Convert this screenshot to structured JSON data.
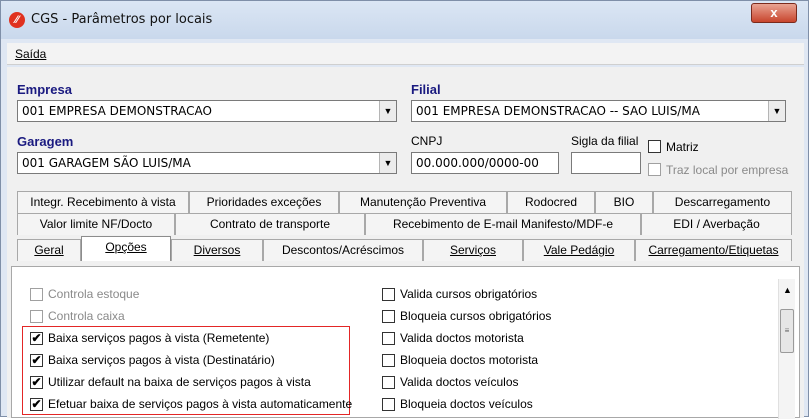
{
  "window": {
    "title": "CGS - Parâmetros por locais",
    "close_glyph": "x"
  },
  "menu": {
    "saida": "Saída"
  },
  "form": {
    "empresa_label": "Empresa",
    "empresa_value": "001 EMPRESA DEMONSTRACAO",
    "filial_label": "Filial",
    "filial_value": "001 EMPRESA DEMONSTRACAO -- SAO LUIS/MA",
    "garagem_label": "Garagem",
    "garagem_value": "001 GARAGEM SÃO LUIS/MA",
    "cnpj_label": "CNPJ",
    "cnpj_value": "00.000.000/0000-00",
    "sigla_label": "Sigla da filial",
    "sigla_value": "",
    "matriz_label": "Matriz",
    "traz_local_label": "Traz local por empresa"
  },
  "tabs": {
    "row1": [
      "Integr. Recebimento à vista",
      "Prioridades exceções",
      "Manutenção Preventiva",
      "Rodocred",
      "BIO",
      "Descarregamento"
    ],
    "row2": [
      "Valor limite NF/Docto",
      "Contrato de transporte",
      "Recebimento de E-mail Manifesto/MDF-e",
      "EDI / Averbação"
    ],
    "row3": [
      "Geral",
      "Opções",
      "Diversos",
      "Descontos/Acréscimos",
      "Serviços",
      "Vale Pedágio",
      "Carregamento/Etiquetas"
    ],
    "active": "Opções"
  },
  "options_left": [
    {
      "label": "Controla estoque",
      "checked": false,
      "disabled": true
    },
    {
      "label": "Controla caixa",
      "checked": false,
      "disabled": true
    },
    {
      "label": "Baixa serviços pagos à vista (Remetente)",
      "checked": true,
      "disabled": false
    },
    {
      "label": "Baixa serviços pagos à vista (Destinatário)",
      "checked": true,
      "disabled": false
    },
    {
      "label": "Utilizar default na baixa de serviços pagos à vista",
      "checked": true,
      "disabled": false
    },
    {
      "label": "Efetuar baixa de serviços pagos à vista automaticamente",
      "checked": true,
      "disabled": false
    }
  ],
  "options_right": [
    {
      "label": "Valida cursos obrigatórios",
      "checked": false
    },
    {
      "label": "Bloqueia cursos obrigatórios",
      "checked": false
    },
    {
      "label": "Valida doctos motorista",
      "checked": false
    },
    {
      "label": "Bloqueia doctos motorista",
      "checked": false
    },
    {
      "label": "Valida doctos veículos",
      "checked": false
    },
    {
      "label": "Bloqueia doctos veículos",
      "checked": false
    }
  ],
  "glyphs": {
    "check": "✔",
    "dropdown": "▼",
    "scroll_up": "▲",
    "thumb_grip": "≡"
  },
  "colors": {
    "highlight_box": "#e32626",
    "label_blue": "#1a1a80",
    "app_icon": "#e0311f"
  }
}
